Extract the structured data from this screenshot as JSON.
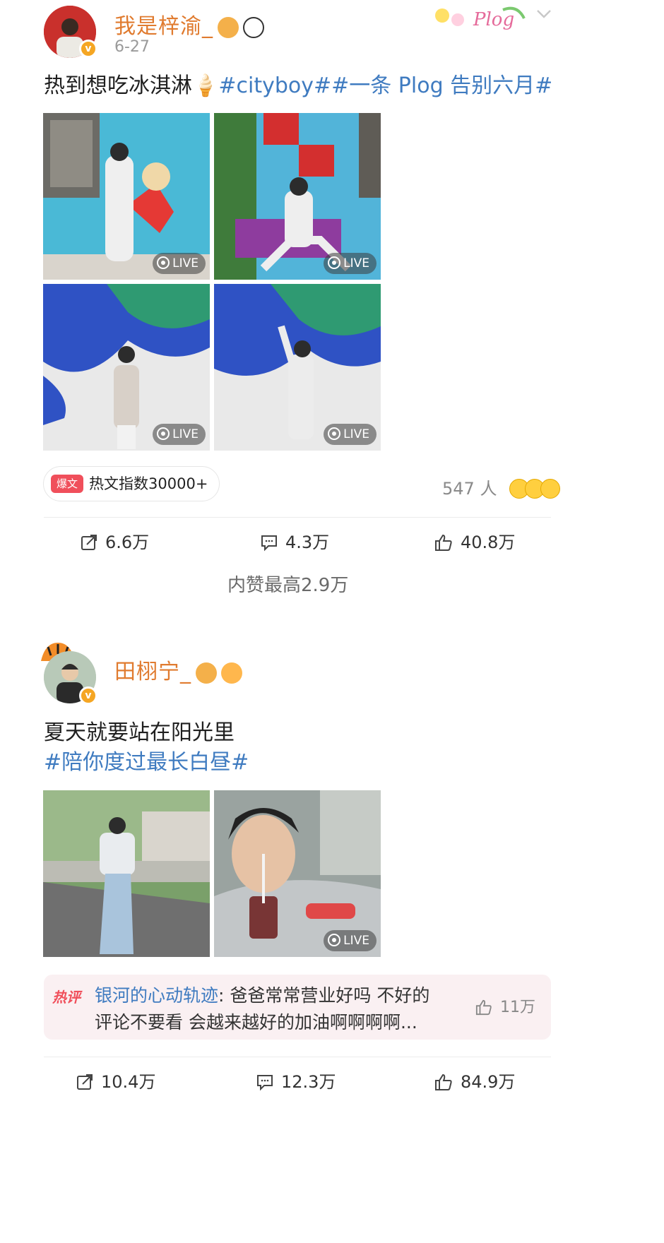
{
  "post1": {
    "username": "我是梓渝_",
    "date": "6-27",
    "deco_text": "Plog",
    "text_plain": "热到想吃冰淇淋🍦",
    "text_tags": "#cityboy##一条 Plog 告别六月#",
    "images": [
      {
        "live_label": "LIVE"
      },
      {
        "live_label": "LIVE"
      },
      {
        "live_label": "LIVE"
      },
      {
        "live_label": "LIVE"
      }
    ],
    "hot_badge": "爆文",
    "hot_index": "热文指数30000+",
    "people": "547 人",
    "actions": {
      "share": "6.6万",
      "comment": "4.3万",
      "like": "40.8万"
    },
    "fold_text": "内赞最高2.9万"
  },
  "post2": {
    "username": "田栩宁_",
    "text_line1": "夏天就要站在阳光里",
    "text_tags": "#陪你度过最长白昼#",
    "images": [
      {
        "live_label": ""
      },
      {
        "live_label": "LIVE"
      }
    ],
    "hot_comment": {
      "tag": "热评",
      "user": "银河的心动轨迹",
      "line1": ": 爸爸常常营业好吗 不好的",
      "line2": "评论不要看 会越来越好的加油啊啊啊啊...",
      "likes": "11万"
    },
    "actions": {
      "share": "10.4万",
      "comment": "12.3万",
      "like": "84.9万"
    }
  },
  "icons": [
    "share-icon",
    "comment-icon",
    "like-icon",
    "live-icon",
    "chevron-down-icon",
    "crown-icon",
    "panda-icon",
    "fish-icon",
    "verified-icon"
  ],
  "colors": {
    "username": "#e07b2f",
    "tag": "#3f7bc0",
    "hot_badge": "#f04f5b",
    "hot_comment_bg": "#faf0f2"
  }
}
